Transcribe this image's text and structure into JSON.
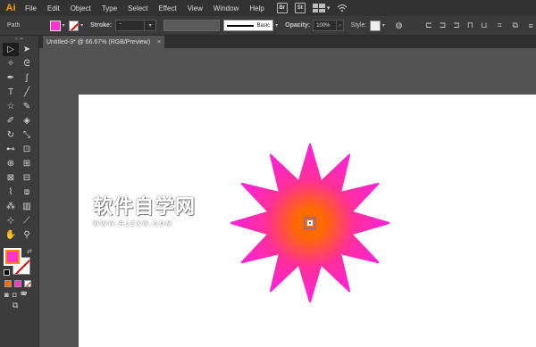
{
  "app": {
    "logo": "Ai"
  },
  "menu": [
    "File",
    "Edit",
    "Object",
    "Type",
    "Select",
    "Effect",
    "View",
    "Window",
    "Help"
  ],
  "bridge": {
    "br": "Br",
    "st": "St"
  },
  "control": {
    "selection_label": "Path",
    "stroke_label": "Stroke:",
    "brush_label": "Basic",
    "opacity_label": "Opacity:",
    "opacity_value": "100%",
    "style_label": "Style:"
  },
  "document": {
    "tab_title": "Untitled-3* @ 66.67% (RGB/Preview)",
    "close": "×"
  },
  "colors": {
    "fill": "#ff33cc",
    "gradient_center": "#ff6a00",
    "gradient_edge": "#ff22dd",
    "artboard": "#ffffff"
  },
  "shape": {
    "type": "star",
    "points": 12
  },
  "watermark": {
    "title": "软件自学网",
    "url": "WWW.RJZXW.COM"
  }
}
